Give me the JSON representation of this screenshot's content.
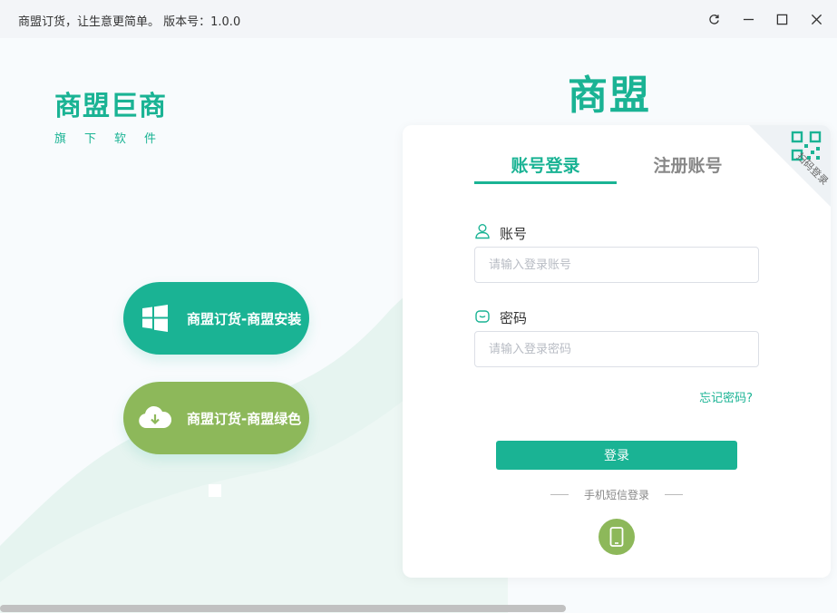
{
  "window": {
    "title": "商盟订货，让生意更简单。 版本号：1.0.0",
    "controls": {
      "refresh": "refresh-icon",
      "minimize": "minimize-icon",
      "maximize": "maximize-icon",
      "close": "close-icon"
    }
  },
  "brand": {
    "logo": "商盟巨商",
    "tagline": "旗下软件"
  },
  "downloads": [
    {
      "label": "商盟订货-商盟安装",
      "icon": "windows-icon",
      "color": "#1ab394"
    },
    {
      "label": "商盟订货-商盟绿色",
      "icon": "cloud-download-icon",
      "color": "#8db85a"
    }
  ],
  "login": {
    "logo": "商盟",
    "qr_label": "扫码登录",
    "tabs": [
      {
        "label": "账号登录",
        "active": true
      },
      {
        "label": "注册账号",
        "active": false
      }
    ],
    "account": {
      "label": "账号",
      "placeholder": "请输入登录账号",
      "value": ""
    },
    "password": {
      "label": "密码",
      "placeholder": "请输入登录密码",
      "value": ""
    },
    "forgot": "忘记密码?",
    "submit": "登录",
    "sms_label": "手机短信登录"
  },
  "colors": {
    "accent": "#1ab394",
    "secondary": "#8db85a"
  }
}
